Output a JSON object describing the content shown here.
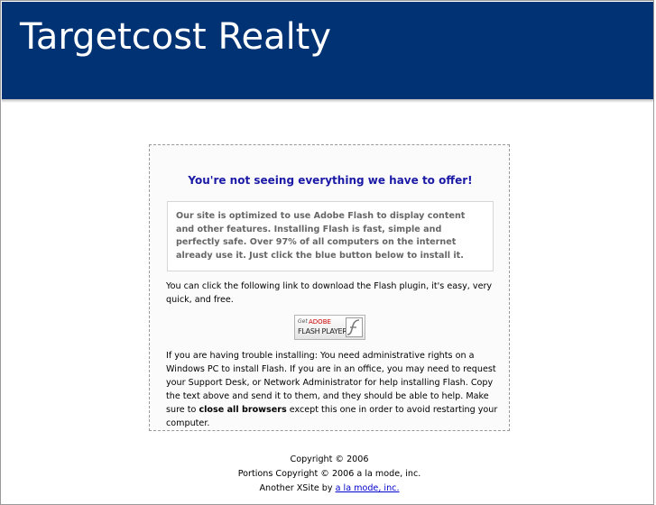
{
  "header": {
    "title": "Targetcost Realty",
    "background_color": "#003274"
  },
  "notice": {
    "heading": "You're not seeing everything we have to offer!",
    "info": "Our site is optimized to use Adobe Flash to display content and other features. Installing Flash is fast, simple and perfectly safe. Over 97% of all computers on the internet already use it. Just click the blue button below to install it.",
    "download_text": "You can click the following link to download the Flash plugin, it's easy, very quick, and free.",
    "flash_badge": {
      "get": "Get",
      "adobe": "ADOBE",
      "player": "FLASH PLAYER",
      "icon": "flash-logo-icon"
    },
    "trouble_text": "If you are having trouble installing: You need administrative rights on a Windows PC to install Flash. If you are in an office, you may need to request your Support Desk, or Network Administrator for help installing Flash. Copy the text above and send it to them, and they should be able to help. Make sure to ",
    "trouble_bold": "close all browsers",
    "trouble_end": " except this one in order to avoid restarting your computer."
  },
  "footer": {
    "copyright": "Copyright © 2006",
    "portions": "Portions Copyright © 2006 a la mode, inc.",
    "xsite_prefix": "Another XSite by ",
    "xsite_link": "a la mode, inc."
  }
}
